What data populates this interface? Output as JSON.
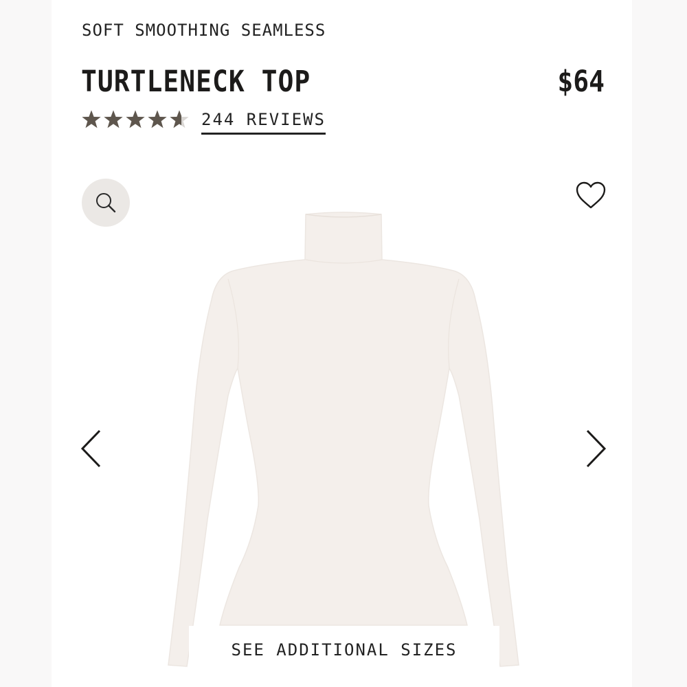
{
  "product": {
    "collection": "SOFT SMOOTHING SEAMLESS",
    "title": "TURTLENECK TOP",
    "price": "$64"
  },
  "rating": {
    "stars_value": 4.6,
    "stars_max": 5,
    "reviews_label": "244 REVIEWS",
    "star_color": "#5e564d",
    "empty_star_color": "#d9d6d3"
  },
  "gallery": {
    "zoom_icon": "magnifier-icon",
    "wishlist_icon": "heart-outline-icon",
    "prev_icon": "chevron-left-icon",
    "next_icon": "chevron-right-icon",
    "image_color": "#f4efeb",
    "zoom_button_bg": "#ebe8e5"
  },
  "sizes_button": {
    "label": "SEE ADDITIONAL SIZES"
  }
}
